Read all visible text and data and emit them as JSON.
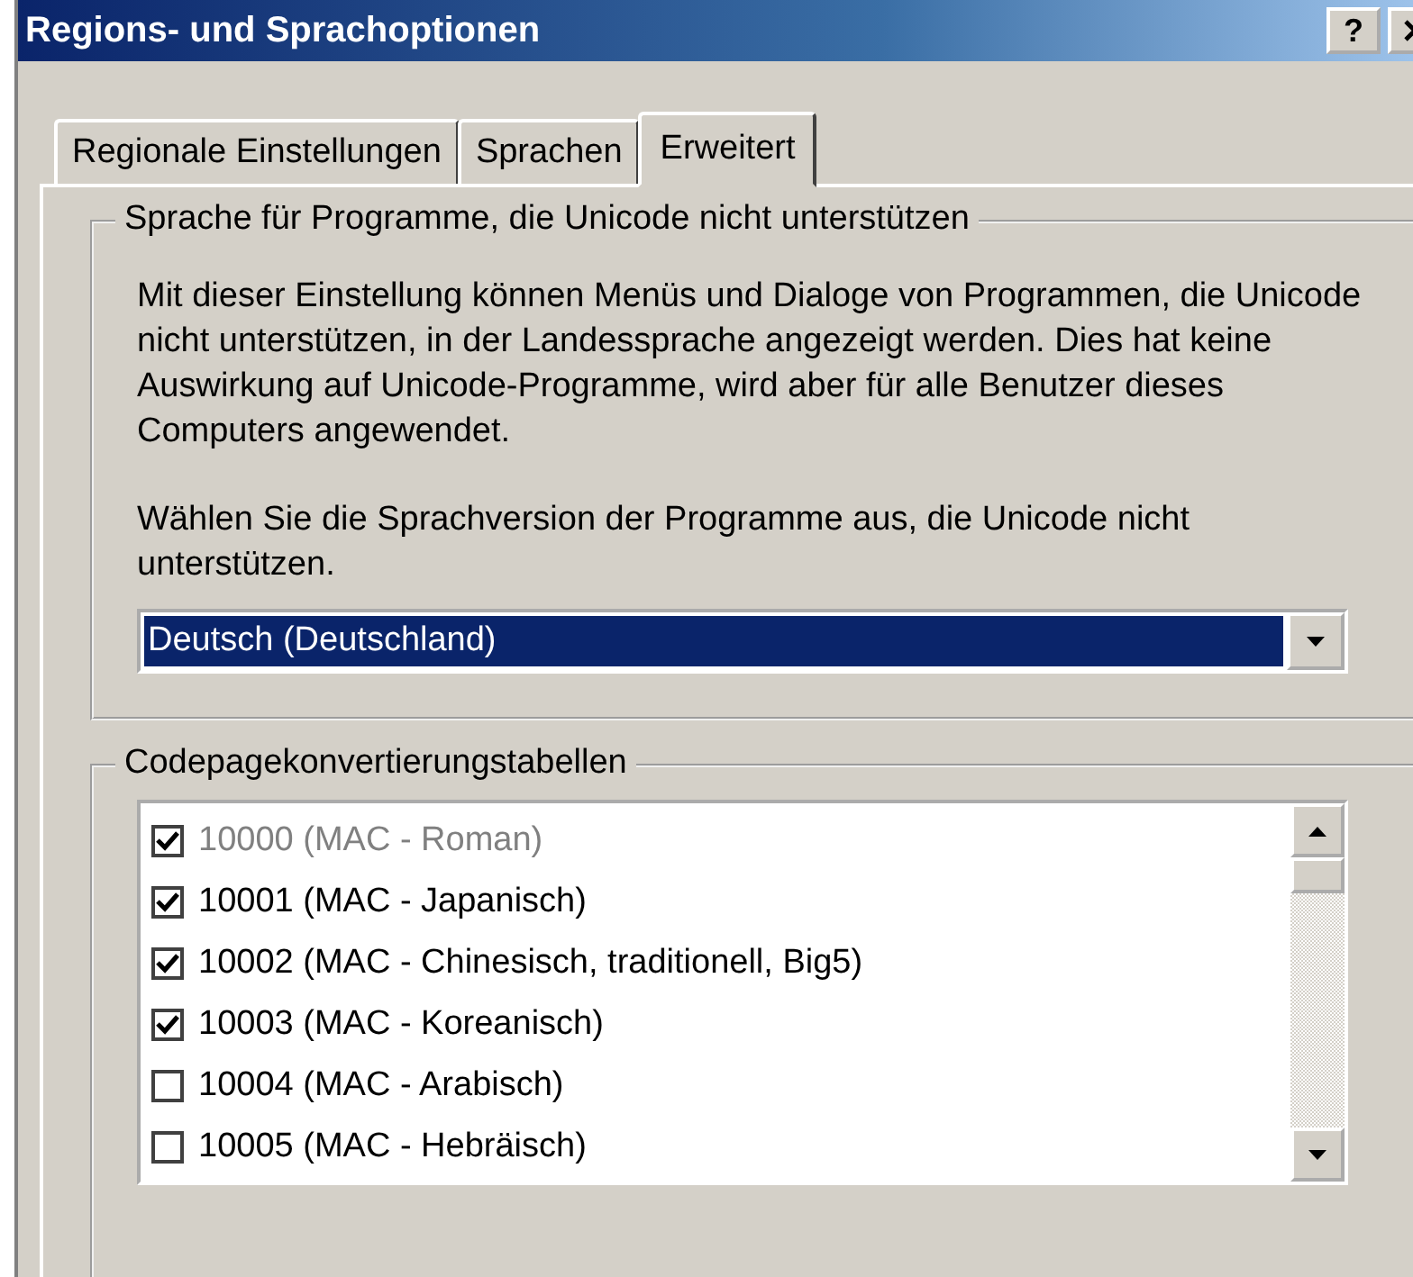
{
  "window": {
    "title": "Regions- und Sprachoptionen",
    "help_button": "?"
  },
  "tabs": [
    {
      "label": "Regionale Einstellungen",
      "selected": false
    },
    {
      "label": "Sprachen",
      "selected": false
    },
    {
      "label": "Erweitert",
      "selected": true
    }
  ],
  "non_unicode_group": {
    "title": "Sprache für Programme, die Unicode nicht unterstützen",
    "description": "Mit dieser Einstellung können Menüs und Dialoge von Programmen, die Unicode nicht unterstützen, in der Landessprache angezeigt werden. Dies hat keine Auswirkung auf Unicode-Programme, wird aber für alle Benutzer dieses Computers angewendet.",
    "prompt": "Wählen Sie die Sprachversion der Programme aus, die Unicode nicht unterstützen.",
    "dropdown": {
      "value": "Deutsch (Deutschland)"
    }
  },
  "codepage_group": {
    "title": "Codepagekonvertierungstabellen",
    "items": [
      {
        "label": "10000 (MAC - Roman)",
        "checked": true,
        "disabled": true
      },
      {
        "label": "10001 (MAC - Japanisch)",
        "checked": true,
        "disabled": false
      },
      {
        "label": "10002 (MAC - Chinesisch, traditionell, Big5)",
        "checked": true,
        "disabled": false
      },
      {
        "label": "10003 (MAC - Koreanisch)",
        "checked": true,
        "disabled": false
      },
      {
        "label": "10004 (MAC - Arabisch)",
        "checked": false,
        "disabled": false
      },
      {
        "label": "10005 (MAC - Hebräisch)",
        "checked": false,
        "disabled": false
      }
    ]
  }
}
